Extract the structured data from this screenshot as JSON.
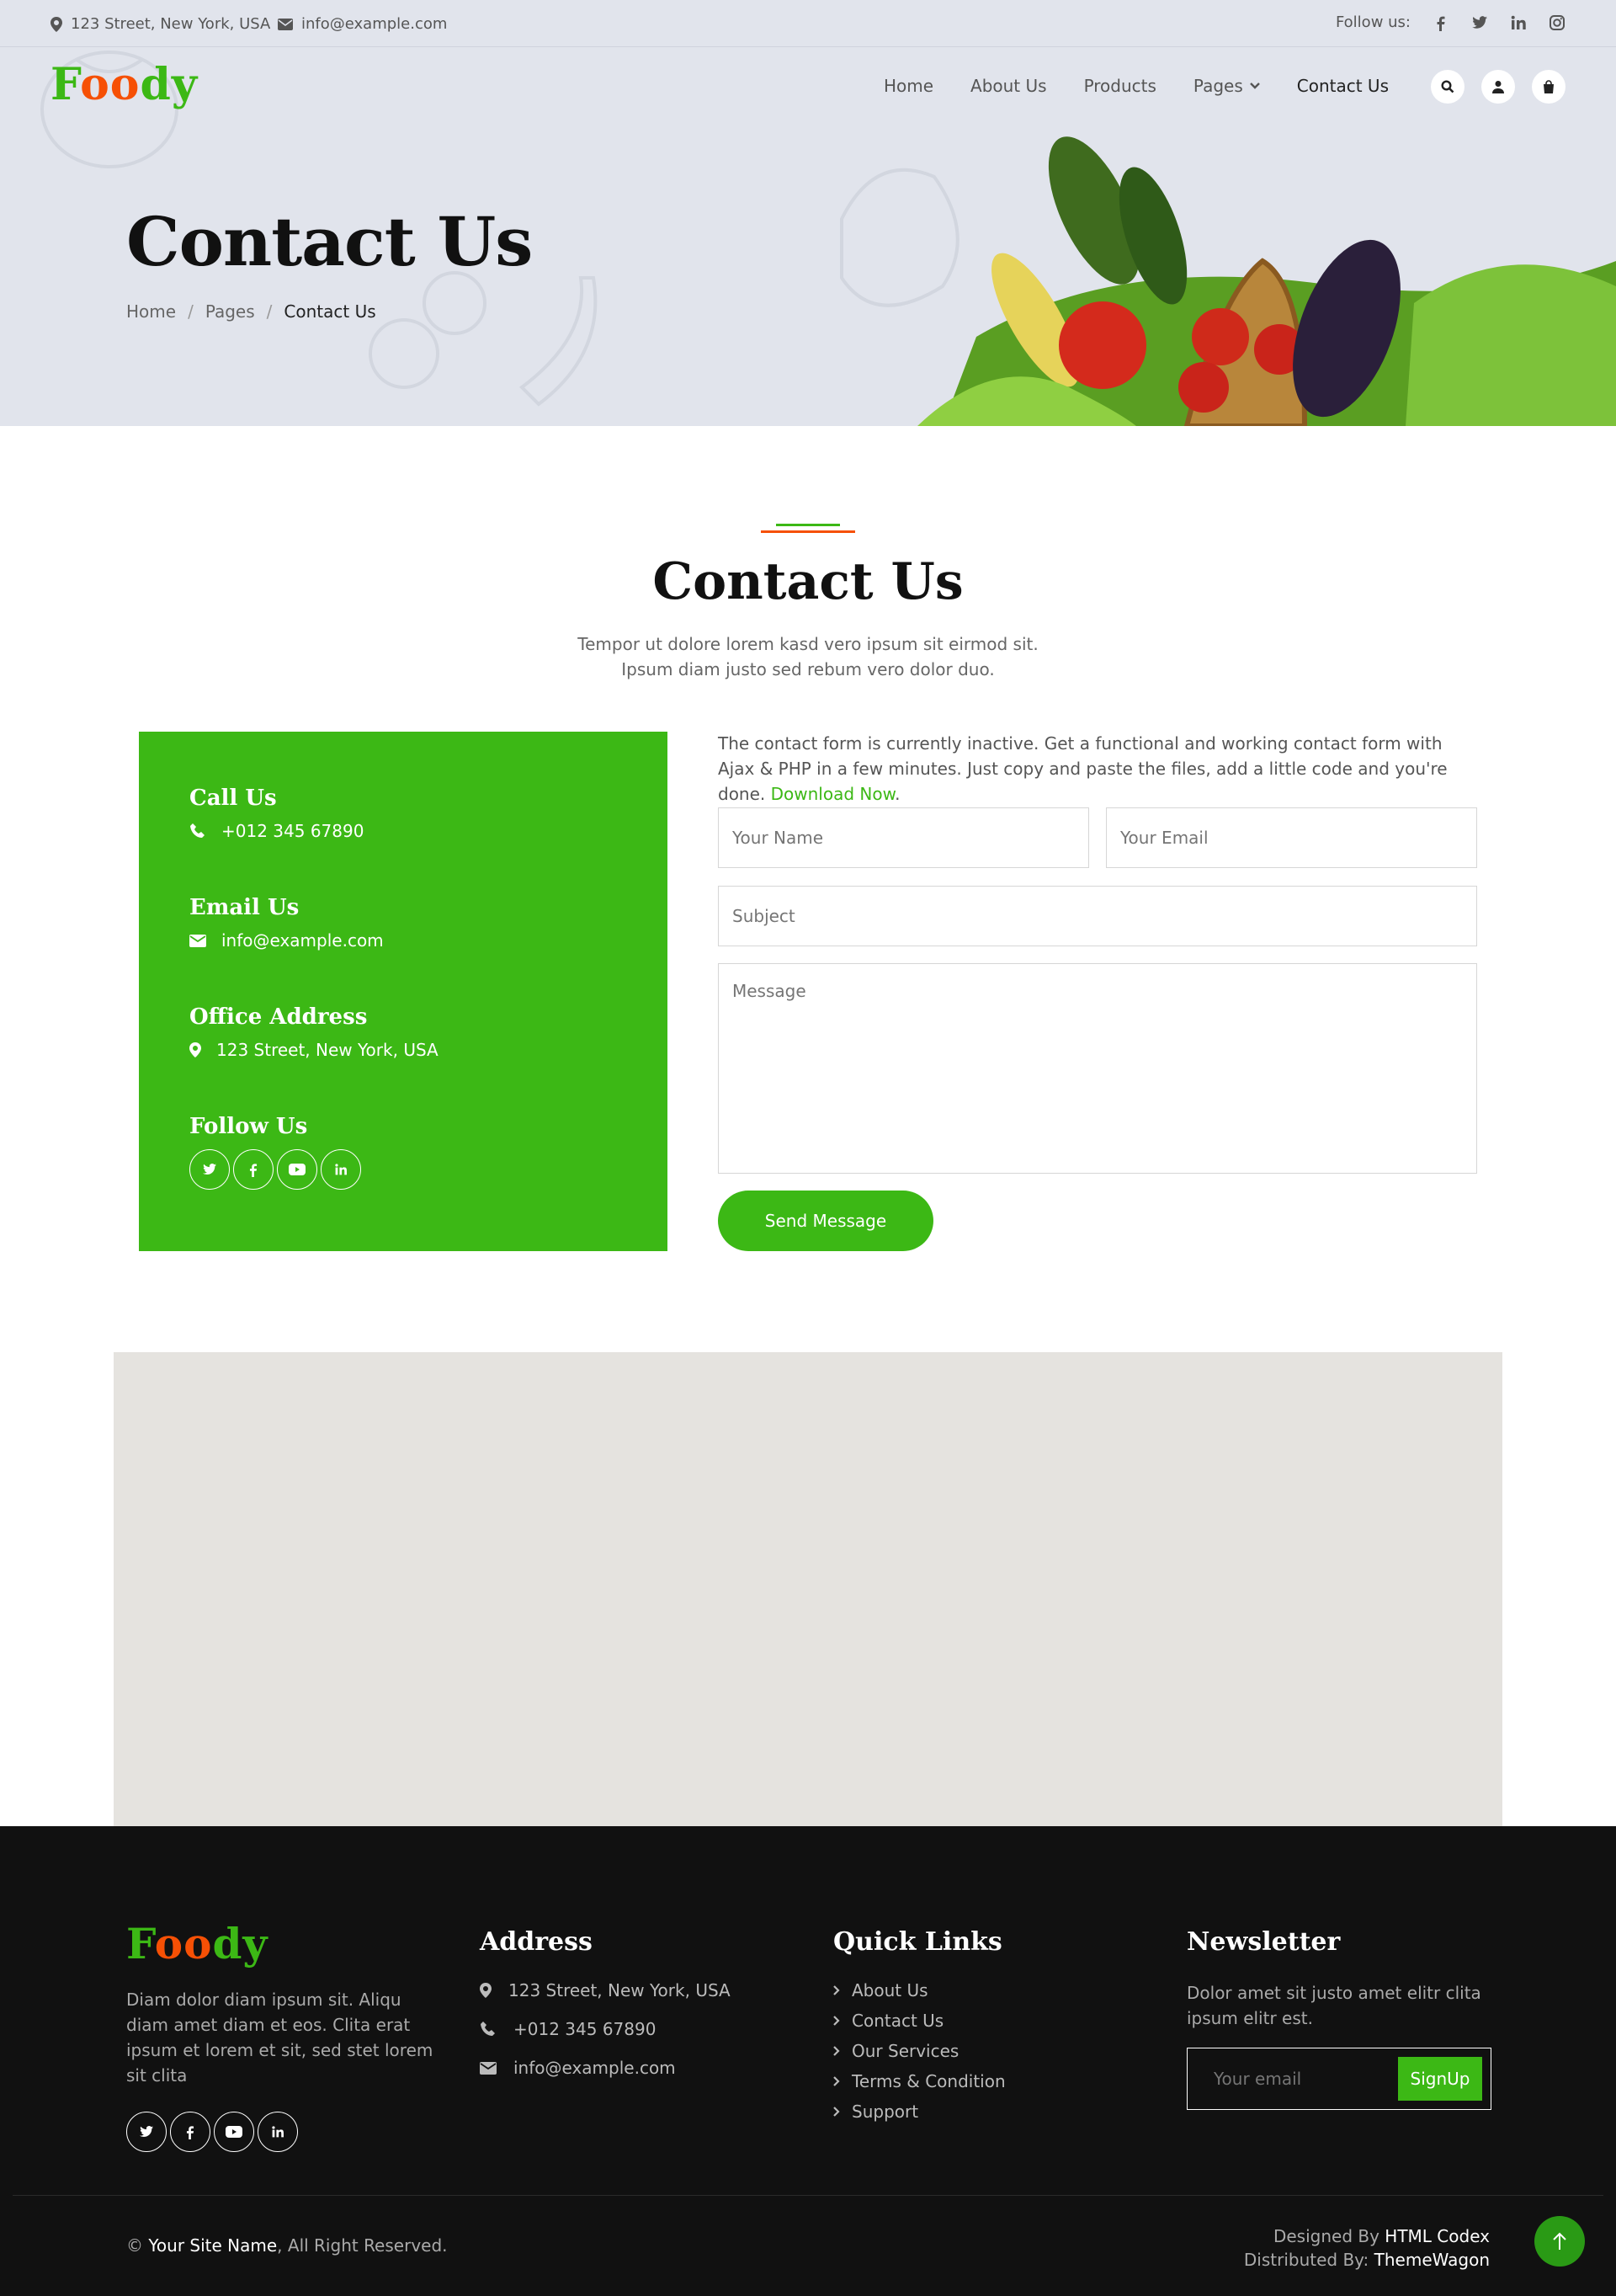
{
  "topbar": {
    "address": "123 Street, New York, USA",
    "email": "info@example.com",
    "follow_label": "Follow us:"
  },
  "brand": {
    "part1": "F",
    "part2": "oo",
    "part3": "dy"
  },
  "nav": {
    "items": [
      "Home",
      "About Us",
      "Products",
      "Pages",
      "Contact Us"
    ]
  },
  "hero": {
    "title": "Contact Us",
    "breadcrumb": [
      "Home",
      "Pages",
      "Contact Us"
    ],
    "separator": "/"
  },
  "contact": {
    "title": "Contact Us",
    "subtitle": "Tempor ut dolore lorem kasd vero ipsum sit eirmod sit. Ipsum diam justo sed rebum vero dolor duo.",
    "call_heading": "Call Us",
    "call_value": "+012 345 67890",
    "email_heading": "Email Us",
    "email_value": "info@example.com",
    "office_heading": "Office Address",
    "office_value": "123 Street, New York, USA",
    "follow_heading": "Follow Us"
  },
  "form": {
    "note": "The contact form is currently inactive. Get a functional and working contact form with Ajax & PHP in a few minutes. Just copy and paste the files, add a little code and you're done.",
    "download_link": "Download Now",
    "note_end": ".",
    "name_placeholder": "Your Name",
    "email_placeholder": "Your Email",
    "subject_placeholder": "Subject",
    "message_placeholder": "Message",
    "submit_label": "Send Message"
  },
  "footer": {
    "about_text": "Diam dolor diam ipsum sit. Aliqu diam amet diam et eos. Clita erat ipsum et lorem et sit, sed stet lorem sit clita",
    "address_heading": "Address",
    "address": "123 Street, New York, USA",
    "phone": "+012 345 67890",
    "email": "info@example.com",
    "links_heading": "Quick Links",
    "links": [
      "About Us",
      "Contact Us",
      "Our Services",
      "Terms & Condition",
      "Support"
    ],
    "newsletter_heading": "Newsletter",
    "newsletter_text": "Dolor amet sit justo amet elitr clita ipsum elitr est.",
    "newsletter_placeholder": "Your email",
    "newsletter_button": "SignUp",
    "copyright_symbol": "©",
    "site_name": "Your Site Name",
    "rights": ", All Right Reserved.",
    "designed_by": "Designed By",
    "designer": "HTML Codex",
    "distributed_by": "Distributed By:",
    "distributor": "ThemeWagon"
  },
  "colors": {
    "primary": "#3cb815",
    "secondary": "#f65005",
    "dark": "#111111",
    "hero_bg": "#e1e4ec"
  }
}
